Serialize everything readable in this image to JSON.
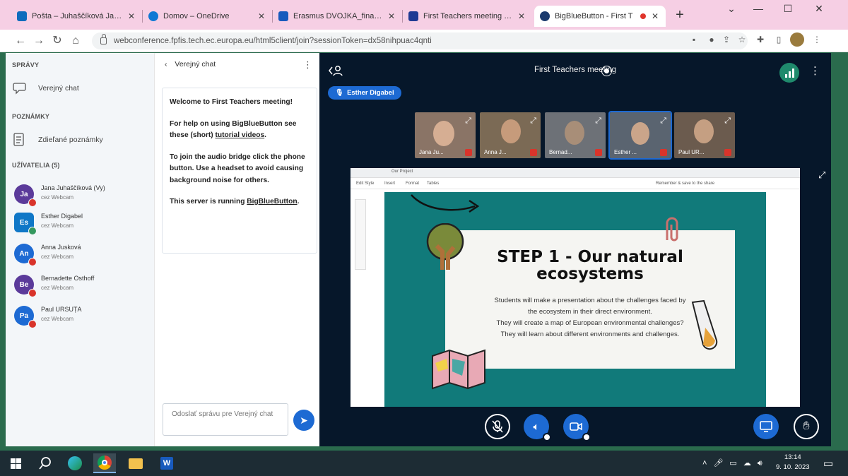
{
  "browser": {
    "tabs": [
      {
        "label": "Pošta – Juhaščíková Jana –",
        "icon": "outlook-icon",
        "color": "#0f6cbd",
        "active": false
      },
      {
        "label": "Domov – OneDrive",
        "icon": "onedrive-icon",
        "color": "#0f78d4",
        "active": false
      },
      {
        "label": "Erasmus DVOJKA_final.doc",
        "icon": "word-icon",
        "color": "#185abd",
        "active": false
      },
      {
        "label": "First Teachers meeting | E",
        "icon": "eu-icon",
        "color": "#1f3a93",
        "active": false
      },
      {
        "label": "BigBlueButton - First T",
        "icon": "bbb-icon",
        "color": "#1c3b6e",
        "active": true
      }
    ],
    "new_tab": "+",
    "url": "webconference.fpfis.tech.ec.europa.eu/html5client/join?sessionToken=dx58nihpuac4qnti"
  },
  "sidebar": {
    "messages_header": "SPRÁVY",
    "public_chat": "Verejný chat",
    "notes_header": "POZNÁMKY",
    "shared_notes": "Zdieľané poznámky",
    "users_header": "UŽÍVATELIA (5)",
    "users": [
      {
        "initials": "Ja",
        "name": "Jana Juhaščíková (Vy)",
        "status": "cez Webcam",
        "color": "#5b3a9a"
      },
      {
        "initials": "Es",
        "name": "Esther Digabel",
        "status": "cez Webcam",
        "color": "#0f77c7"
      },
      {
        "initials": "An",
        "name": "Anna Jusková",
        "status": "cez Webcam",
        "color": "#1d6ad3"
      },
      {
        "initials": "Be",
        "name": "Bernadette Osthoff",
        "status": "cez Webcam",
        "color": "#5b3a9a"
      },
      {
        "initials": "Pa",
        "name": "Paul URSUȚA",
        "status": "cez Webcam",
        "color": "#1d6ad3"
      }
    ]
  },
  "chat": {
    "title": "Verejný chat",
    "welcome": "Welcome to First Teachers meeting!",
    "help_pre": "For help on using BigBlueButton see these (short) ",
    "help_link": "tutorial videos",
    "help_post": ".",
    "audio": "To join the audio bridge click the phone button. Use a headset to avoid causing background noise for others.",
    "server_pre": "This server is running ",
    "server_link": "BigBlueButton",
    "server_post": ".",
    "input_placeholder": "Odoslať správu pre Verejný chat"
  },
  "meeting": {
    "title": "First Teachers meeting",
    "talker": "Esther Digabel",
    "cams": [
      {
        "label": "Jana Ju...",
        "bg": "#8a7466"
      },
      {
        "label": "Anna J...",
        "bg": "#7b6a55"
      },
      {
        "label": "Bernad...",
        "bg": "#6d7177"
      },
      {
        "label": "Esther ...",
        "bg": "#5a6470"
      },
      {
        "label": "Paul UR...",
        "bg": "#6b5b4e"
      }
    ]
  },
  "slide": {
    "title_line1": "STEP 1 - Our natural",
    "title_line2": "ecosystems",
    "body": [
      "Students will make a presentation about the challenges faced by",
      "the ecosystem in their direct environment.",
      "They will create a map of European environmental challenges?",
      "They will learn about different environments and challenges."
    ],
    "inner_tab": "Our Project",
    "inner_menu": [
      "Edit Style",
      "Insert",
      "Format",
      "Tables"
    ],
    "inner_right": "Remember & save to the share"
  },
  "taskbar": {
    "time": "13:14",
    "date": "9. 10. 2023"
  }
}
